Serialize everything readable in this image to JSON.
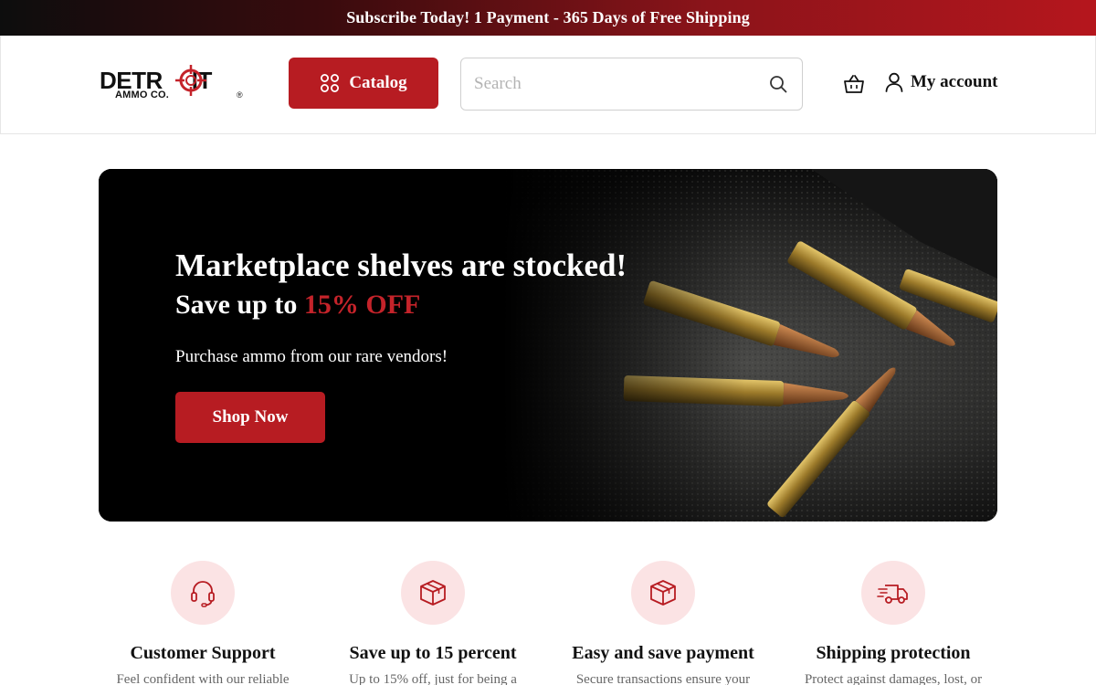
{
  "announcement": {
    "text": "Subscribe Today! 1 Payment - 365 Days of Free Shipping"
  },
  "header": {
    "logo": {
      "word_left": "DETR",
      "word_right": "IT",
      "sub": "AMMO CO.",
      "reg": "®"
    },
    "catalog_label": "Catalog",
    "search_placeholder": "Search",
    "account_label": "My account"
  },
  "hero": {
    "title": "Marketplace shelves are stocked!",
    "subtitle_prefix": "Save up to ",
    "subtitle_highlight": "15% OFF",
    "description": "Purchase ammo from our rare vendors!",
    "cta_label": "Shop Now"
  },
  "features": [
    {
      "icon": "headset-icon",
      "title": "Customer Support",
      "description": "Feel confident with our reliable"
    },
    {
      "icon": "box-icon",
      "title": "Save up to 15 percent",
      "description": "Up to 15% off, just for being a"
    },
    {
      "icon": "box-icon",
      "title": "Easy and save payment",
      "description": "Secure transactions ensure your"
    },
    {
      "icon": "delivery-truck-icon",
      "title": "Shipping protection",
      "description": "Protect against damages, lost, or"
    }
  ],
  "colors": {
    "brand_red": "#b71c22",
    "accent_red": "#c4232a",
    "icon_bg": "#fbe3e4"
  }
}
